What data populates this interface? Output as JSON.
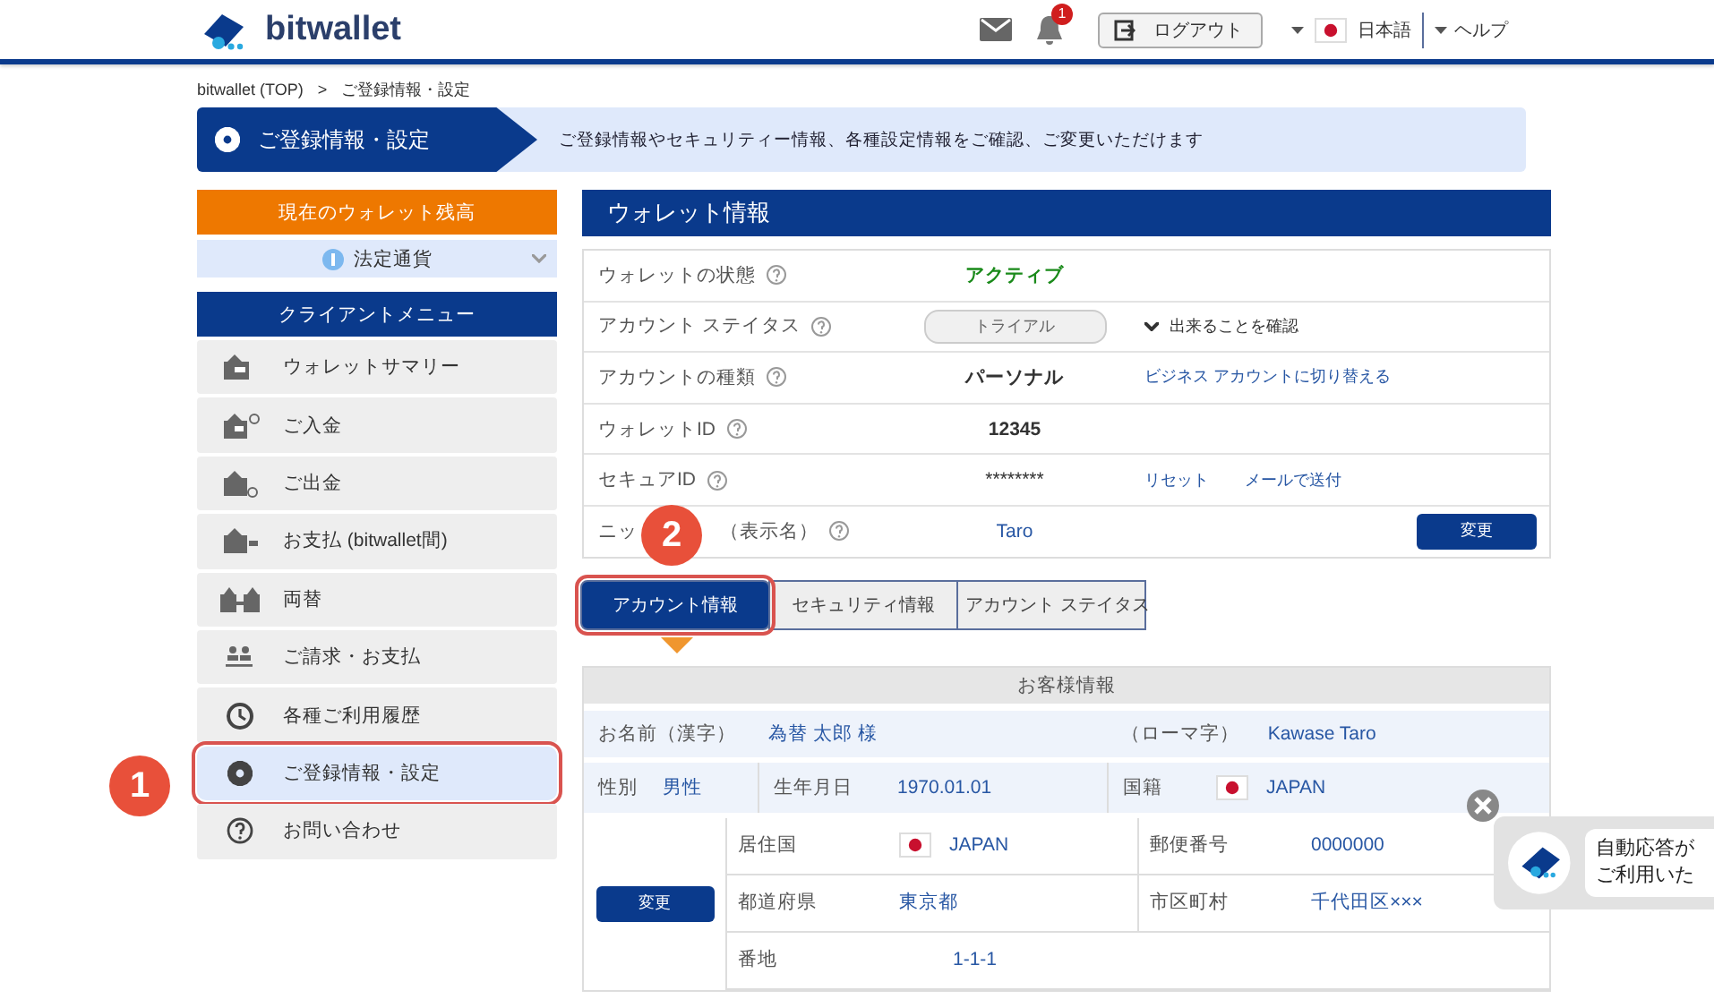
{
  "header": {
    "logo": "bitwallet",
    "notification_count": "1",
    "logout": "ログアウト",
    "language": "日本語",
    "help": "ヘルプ"
  },
  "breadcrumb": {
    "items": [
      "bitwallet (TOP)",
      "ご登録情報・設定"
    ],
    "separator": ">"
  },
  "banner": {
    "title": "ご登録情報・設定",
    "description": "ご登録情報やセキュリティー情報、各種設定情報をご確認、ご変更いただけます"
  },
  "sidebar": {
    "balance_title": "現在のウォレット残高",
    "currency": "法定通貨",
    "menu_title": "クライアントメニュー",
    "items": [
      {
        "label": "ウォレットサマリー",
        "selected": false,
        "highlighted": false
      },
      {
        "label": "ご入金",
        "selected": false,
        "highlighted": false
      },
      {
        "label": "ご出金",
        "selected": false,
        "highlighted": false
      },
      {
        "label": "お支払 (bitwallet間)",
        "selected": false,
        "highlighted": false
      },
      {
        "label": "両替",
        "selected": false,
        "highlighted": false
      },
      {
        "label": "ご請求・お支払",
        "selected": false,
        "highlighted": false
      },
      {
        "label": "各種ご利用履歴",
        "selected": false,
        "highlighted": false
      },
      {
        "label": "ご登録情報・設定",
        "selected": true,
        "highlighted": true
      },
      {
        "label": "お問い合わせ",
        "selected": false,
        "highlighted": false
      }
    ]
  },
  "wallet_info": {
    "title": "ウォレット情報",
    "rows": [
      {
        "label": [
          "ウォレットの状態"
        ],
        "kind": "status",
        "value": "アクティブ"
      },
      {
        "label": [
          "アカウント ステイタス"
        ],
        "kind": "pill",
        "value": "トライアル",
        "expander": "出来ることを確認"
      },
      {
        "label": [
          "アカウントの種類"
        ],
        "kind": "bold",
        "value": "パーソナル",
        "links": [
          "ビジネス アカウントに切り替える"
        ]
      },
      {
        "label": [
          "ウォレットID"
        ],
        "kind": "bold",
        "value": "12345"
      },
      {
        "label": [
          "セキュアID"
        ],
        "kind": "plain",
        "value": "********",
        "links": [
          "リセット",
          "メールで送付"
        ]
      },
      {
        "label": [
          "ニッ",
          "（表示名）"
        ],
        "kind": "link",
        "value": "Taro",
        "button": "変更"
      }
    ]
  },
  "tabs": [
    {
      "label": "アカウント情報",
      "selected": true,
      "highlighted": true
    },
    {
      "label": "セキュリティ情報",
      "selected": false,
      "highlighted": false
    },
    {
      "label": "アカウント ステイタス",
      "selected": false,
      "highlighted": false
    }
  ],
  "customer": {
    "title": "お客様情報",
    "name_row": [
      {
        "label": "お名前（漢字）",
        "value": "為替 太郎 様"
      },
      {
        "label": "（ローマ字）",
        "value": "Kawase Taro"
      }
    ],
    "personal_row": [
      {
        "label": "性別",
        "value": "男性",
        "flag": false
      },
      {
        "label": "生年月日",
        "value": "1970.01.01",
        "flag": false
      },
      {
        "label": "国籍",
        "value": "JAPAN",
        "flag": true
      }
    ],
    "address": {
      "button": "変更",
      "rows": [
        [
          {
            "label": "居住国",
            "value": "JAPAN",
            "flag": true
          },
          {
            "label": "郵便番号",
            "value": "0000000",
            "flag": false
          }
        ],
        [
          {
            "label": "都道府県",
            "value": "東京都",
            "flag": false
          },
          {
            "label": "市区町村",
            "value": "千代田区×××",
            "flag": false
          }
        ],
        [
          {
            "label": "番地",
            "value": "1-1-1",
            "flag": false
          }
        ]
      ]
    }
  },
  "annotations": [
    "1",
    "2"
  ],
  "chat": {
    "lines": [
      "自動応答が",
      "ご利用いた"
    ]
  }
}
